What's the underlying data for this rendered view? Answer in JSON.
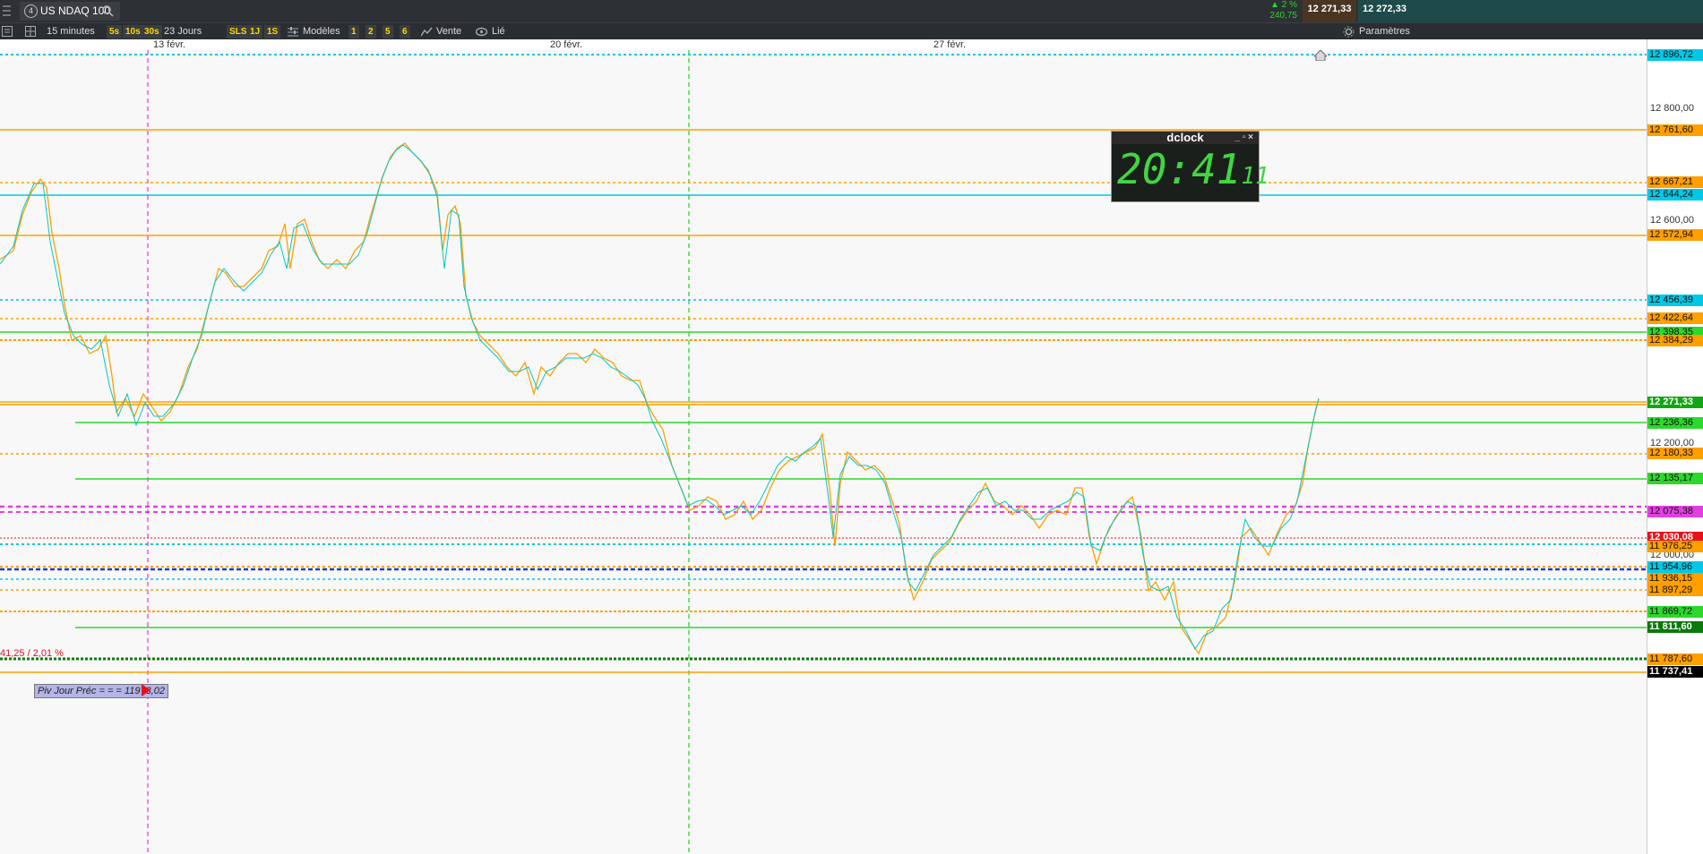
{
  "topbar": {
    "symbol_badge": "4",
    "symbol": "US NDAQ 100",
    "change_pct": "▲ 2 %",
    "change_abs": "240,75",
    "bid": "12 271,33",
    "ask": "12 272,33"
  },
  "toolbar": {
    "timeframe": "15 minutes",
    "quick_buttons": [
      "5s",
      "10s",
      "30s"
    ],
    "range": "23 Jours",
    "sls": "SLS",
    "periods": [
      "1J",
      "1S"
    ],
    "models": "Modèles",
    "templates": [
      "1",
      "2",
      "5",
      "6"
    ],
    "sell": "Vente",
    "linked": "Lié",
    "settings": "Paramètres"
  },
  "dates": [
    "13 févr.",
    "20 févr.",
    "27 févr."
  ],
  "dclock": {
    "title": "dclock",
    "time": "20:41",
    "seconds": "11"
  },
  "annotations": {
    "pct_change": "41,25 / 2,01 %",
    "pivot_label": "Piv Jour  Préc  = = = 11973,02"
  },
  "axis_ticks": [
    "12 800,00",
    "12 600,00",
    "12 200,00",
    "12 000,00"
  ],
  "price_labels": [
    {
      "text": "12 896,72",
      "bg": "#00c8e6"
    },
    {
      "text": "12 761,60",
      "bg": "#ff9f00"
    },
    {
      "text": "12 667,21",
      "bg": "#ff9f00"
    },
    {
      "text": "12 644,24",
      "bg": "#00c8e6"
    },
    {
      "text": "12 572,94",
      "bg": "#ff9f00"
    },
    {
      "text": "12 456,39",
      "bg": "#00c8e6"
    },
    {
      "text": "12 422,64",
      "bg": "#ff9f00"
    },
    {
      "text": "12 398,35",
      "bg": "#2bd82b"
    },
    {
      "text": "12 384,29",
      "bg": "#ff9f00"
    },
    {
      "text": "12 271,33",
      "bg": "#14a514"
    },
    {
      "text": "12 236,36",
      "bg": "#2bd82b"
    },
    {
      "text": "12 180,33",
      "bg": "#ff9f00"
    },
    {
      "text": "12 135,17",
      "bg": "#2bd82b"
    },
    {
      "text": "12 075,38",
      "bg": "#e040e0"
    },
    {
      "text": "12 030,08",
      "bg": "#e8101a"
    },
    {
      "text": "11 976,25",
      "bg": "#ff9f00"
    },
    {
      "text": "11 954,96",
      "bg": "#00c8e6"
    },
    {
      "text": "11 936,15",
      "bg": "#ff9f00"
    },
    {
      "text": "11 897,29",
      "bg": "#ff9f00"
    },
    {
      "text": "11 869,72",
      "bg": "#2bd82b"
    },
    {
      "text": "11 811,60",
      "bg": "#0a7a0a"
    },
    {
      "text": "11 787,60",
      "bg": "#ff9f00"
    },
    {
      "text": "11 737,41",
      "bg": "#000000"
    }
  ]
}
